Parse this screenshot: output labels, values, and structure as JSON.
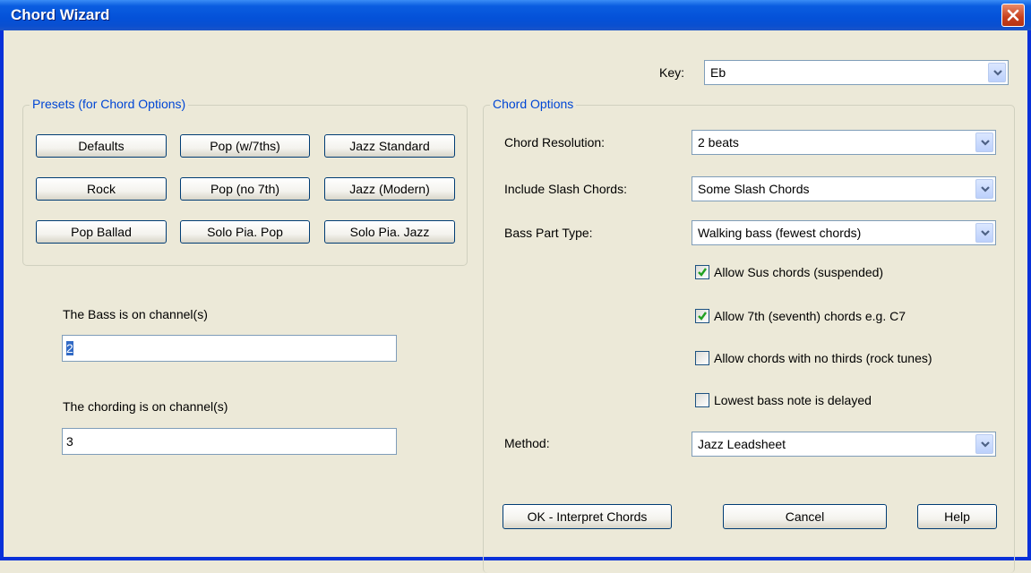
{
  "window": {
    "title": "Chord Wizard"
  },
  "key": {
    "label": "Key:",
    "value": "Eb"
  },
  "presets": {
    "legend": "Presets  (for Chord Options)",
    "buttons": [
      "Defaults",
      "Pop (w/7ths)",
      "Jazz Standard",
      "Rock",
      "Pop (no 7th)",
      "Jazz (Modern)",
      "Pop Ballad",
      "Solo Pia. Pop",
      "Solo Pia. Jazz"
    ]
  },
  "channels": {
    "bass_label": "The Bass is on channel(s)",
    "bass_value": "2",
    "chording_label": "The chording is on channel(s)",
    "chording_value": "3"
  },
  "options": {
    "legend": "Chord Options",
    "resolution_label": "Chord Resolution:",
    "resolution_value": "2 beats",
    "slash_label": "Include Slash Chords:",
    "slash_value": "Some Slash Chords",
    "bass_type_label": "Bass Part Type:",
    "bass_type_value": "Walking bass (fewest chords)",
    "checkboxes": [
      {
        "label": "Allow Sus chords (suspended)",
        "checked": true
      },
      {
        "label": "Allow 7th (seventh) chords e.g. C7",
        "checked": true
      },
      {
        "label": "Allow chords with no thirds (rock tunes)",
        "checked": false
      },
      {
        "label": "Lowest bass note is delayed",
        "checked": false
      }
    ],
    "method_label": "Method:",
    "method_value": "Jazz Leadsheet"
  },
  "footer": {
    "ok_label": "OK - Interpret Chords",
    "cancel_label": "Cancel",
    "help_label": "Help"
  },
  "icons": {
    "close": "close-icon",
    "dropdown": "chevron-down-icon",
    "check": "checkmark-icon"
  },
  "colors": {
    "title_bar": "#0451d8",
    "legend_text": "#0046d5",
    "close_button": "#c7401e",
    "dialog_bg": "#ece9d8"
  }
}
